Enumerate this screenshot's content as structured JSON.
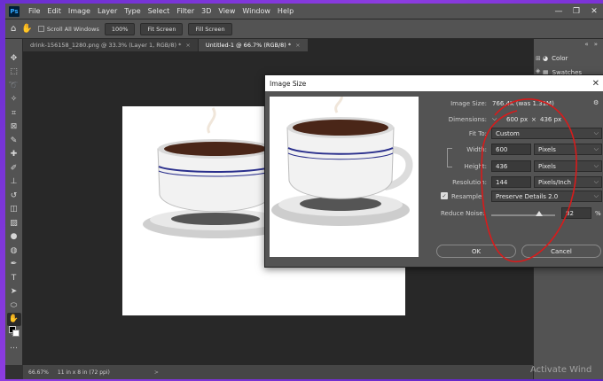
{
  "menubar": {
    "logo": "Ps",
    "items": [
      "File",
      "Edit",
      "Image",
      "Layer",
      "Type",
      "Select",
      "Filter",
      "3D",
      "View",
      "Window",
      "Help"
    ],
    "controls": [
      "—",
      "❐",
      "✕"
    ]
  },
  "options": {
    "scroll_all_windows": "Scroll All Windows",
    "zoom_100": "100%",
    "fit_screen": "Fit Screen",
    "fill_screen": "Fill Screen"
  },
  "tabs": [
    {
      "label": "drink-156158_1280.png @ 33.3% (Layer 1, RGB/8) *",
      "close": "×"
    },
    {
      "label": "Untitled-1 @ 66.7% (RGB/8) *",
      "close": "×"
    }
  ],
  "status": {
    "zoom": "66.67%",
    "doc_info": "11 in x 8 in (72 ppi)",
    "arrow": ">"
  },
  "panel": {
    "color_label": "Color",
    "swatches_label": "Swatches"
  },
  "dialog": {
    "title": "Image Size",
    "close": "✕",
    "image_size_label": "Image Size:",
    "image_size_value": "766.4K (was 1.31M)",
    "dimensions_label": "Dimensions:",
    "dim_w": "600 px",
    "dim_x": "×",
    "dim_h": "436 px",
    "fit_to_label": "Fit To:",
    "fit_to_value": "Custom",
    "width_label": "Width:",
    "width_value": "600",
    "width_unit": "Pixels",
    "height_label": "Height:",
    "height_value": "436",
    "height_unit": "Pixels",
    "resolution_label": "Resolution:",
    "resolution_value": "144",
    "resolution_unit": "Pixels/Inch",
    "resample_label": "Resample:",
    "resample_value": "Preserve Details 2.0",
    "reduce_noise_label": "Reduce Noise:",
    "reduce_noise_value": "82",
    "reduce_noise_unit": "%",
    "reduce_noise_level": 0.41,
    "ok": "OK",
    "cancel": "Cancel"
  },
  "watermark": "Activate Wind",
  "colors": {
    "annotation_red": "#d81b1b",
    "saucer_stripe": "#2a2f8c",
    "coffee": "#4a2618"
  }
}
